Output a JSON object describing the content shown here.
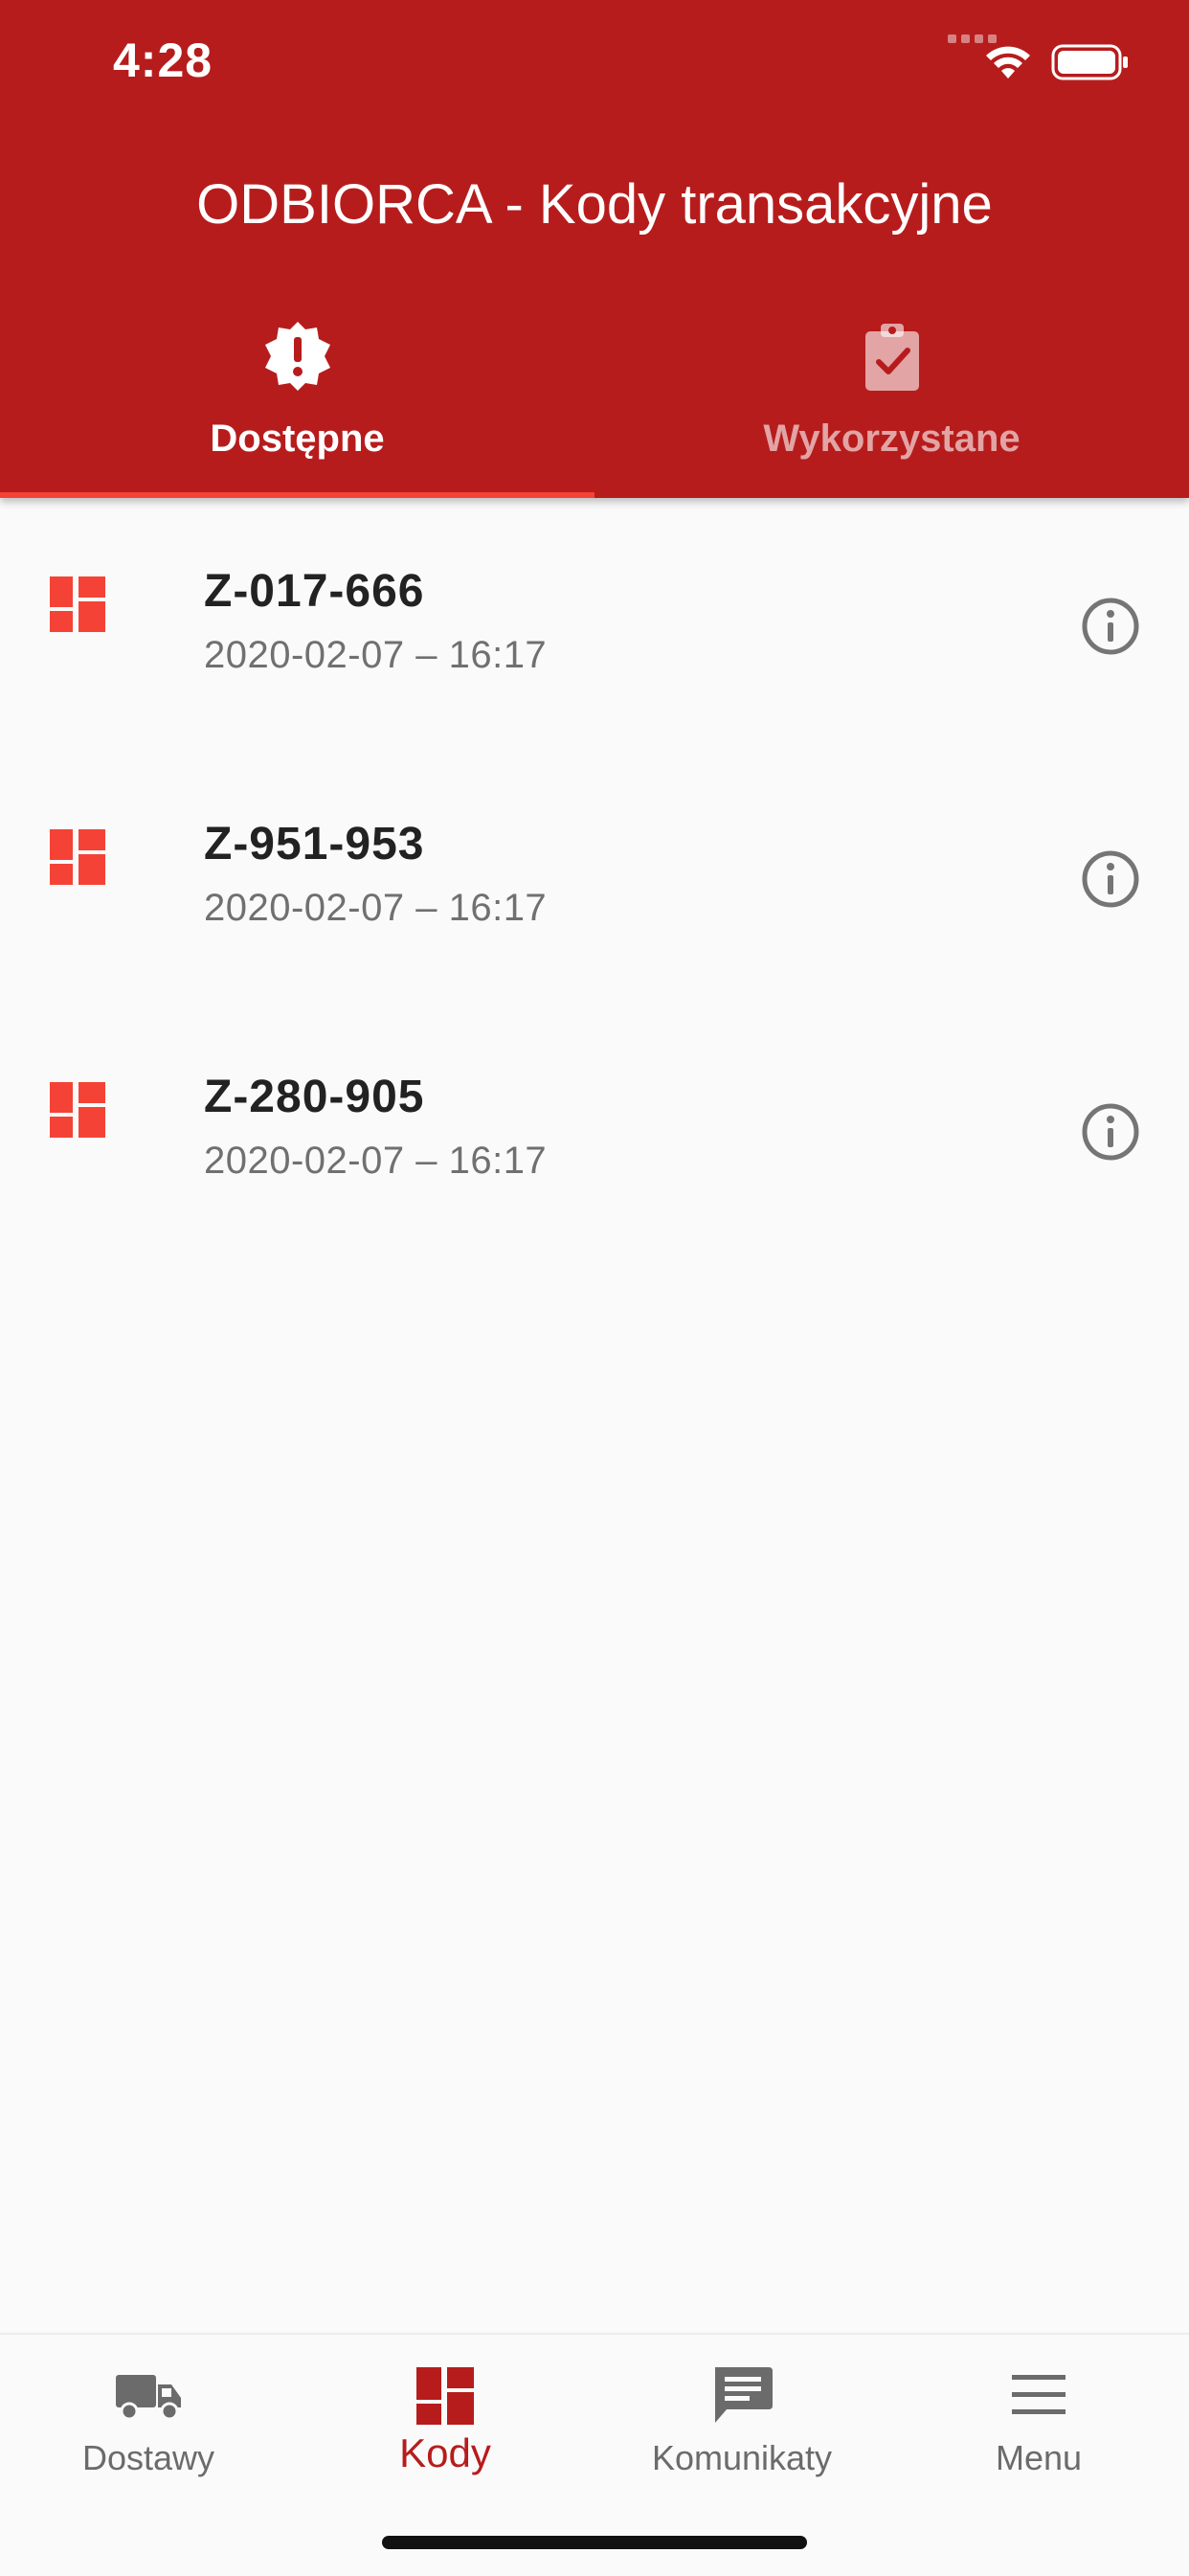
{
  "status_bar": {
    "time": "4:28"
  },
  "header": {
    "title": "ODBIORCA - Kody transakcyjne"
  },
  "tabs": [
    {
      "label": "Dostępne",
      "icon": "alert-badge-icon",
      "active": true
    },
    {
      "label": "Wykorzystane",
      "icon": "clipboard-check-icon",
      "active": false
    }
  ],
  "codes": [
    {
      "code": "Z-017-666",
      "date": "2020-02-07 – 16:17"
    },
    {
      "code": "Z-951-953",
      "date": "2020-02-07 – 16:17"
    },
    {
      "code": "Z-280-905",
      "date": "2020-02-07 – 16:17"
    }
  ],
  "bottom_nav": [
    {
      "label": "Dostawy",
      "icon": "truck-icon",
      "active": false
    },
    {
      "label": "Kody",
      "icon": "dashboard-icon",
      "active": true
    },
    {
      "label": "Komunikaty",
      "icon": "message-icon",
      "active": false
    },
    {
      "label": "Menu",
      "icon": "menu-icon",
      "active": false
    }
  ],
  "colors": {
    "primary": "#b71c1c",
    "accent": "#f44336",
    "background": "#fafafa"
  }
}
